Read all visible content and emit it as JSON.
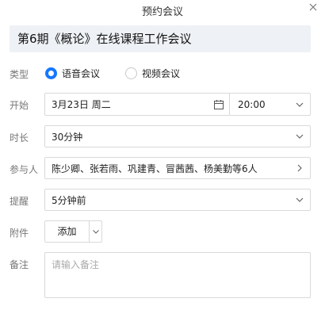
{
  "dialog": {
    "title": "预约会议",
    "subject": "第6期《概论》在线课程工作会议"
  },
  "labels": {
    "type": "类型",
    "start": "开始",
    "duration": "时长",
    "participants": "参与人",
    "reminder": "提醒",
    "attachment": "附件",
    "note": "备注"
  },
  "type_options": [
    {
      "label": "语音会议",
      "selected": true
    },
    {
      "label": "视频会议",
      "selected": false
    }
  ],
  "start": {
    "date": "3月23日 周二",
    "time": "20:00"
  },
  "duration": "30分钟",
  "participants": "陈少卿、张若雨、巩建青、冒茜茜、杨美勤等6人",
  "reminder": "5分钟前",
  "attachment": {
    "add_label": "添加"
  },
  "note": {
    "value": "",
    "placeholder": "请输入备注"
  },
  "colors": {
    "accent": "#1677ff",
    "subject_bg": "#eef1f5",
    "border": "#d9d9d9"
  },
  "icons": [
    "close-icon",
    "calendar-icon",
    "chevron-down-icon",
    "chevron-right-icon"
  ]
}
